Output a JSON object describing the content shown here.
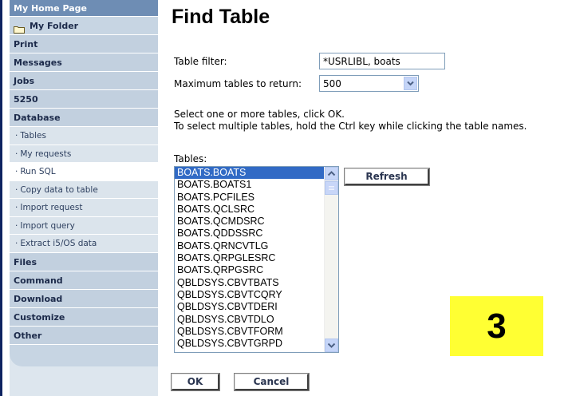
{
  "sidebar": {
    "home": "My Home Page",
    "folder": "My Folder",
    "categories_top": [
      "Print",
      "Messages",
      "Jobs",
      "5250",
      "Database"
    ],
    "database_items": [
      {
        "label": "Tables",
        "active": false
      },
      {
        "label": "My requests",
        "active": false
      },
      {
        "label": "Run SQL",
        "active": true
      },
      {
        "label": "Copy data to table",
        "active": false
      },
      {
        "label": "Import request",
        "active": false
      },
      {
        "label": "Import query",
        "active": false
      },
      {
        "label": "Extract i5/OS data",
        "active": false
      }
    ],
    "categories_bottom": [
      "Files",
      "Command",
      "Download",
      "Customize",
      "Other"
    ],
    "bullet": "·"
  },
  "main": {
    "title": "Find Table",
    "filter_label": "Table filter:",
    "filter_value": "*USRLIBL, boats",
    "max_label": "Maximum tables to return:",
    "max_value": "500",
    "instruction1": "Select one or more tables, click OK.",
    "instruction2": "To select multiple tables, hold the Ctrl key while clicking the table names.",
    "tables_label": "Tables:",
    "tables": [
      "BOATS.BOATS",
      "BOATS.BOATS1",
      "BOATS.PCFILES",
      "BOATS.QCLSRC",
      "BOATS.QCMDSRC",
      "BOATS.QDDSSRC",
      "BOATS.QRNCVTLG",
      "BOATS.QRPGLESRC",
      "BOATS.QRPGSRC",
      "QBLDSYS.CBVTBATS",
      "QBLDSYS.CBVTCQRY",
      "QBLDSYS.CBVTDERI",
      "QBLDSYS.CBVTDLO",
      "QBLDSYS.CBVTFORM",
      "QBLDSYS.CBVTGRPD"
    ],
    "selected_table": "BOATS.BOATS",
    "refresh_label": "Refresh",
    "ok_label": "OK",
    "cancel_label": "Cancel"
  },
  "step_badge": "3",
  "colors": {
    "sidebar_header": "#6e8db4",
    "sidebar_category": "#c2d0df",
    "sidebar_subitem": "#dbe4ec",
    "selection": "#316ac5",
    "badge": "#ffff33"
  }
}
